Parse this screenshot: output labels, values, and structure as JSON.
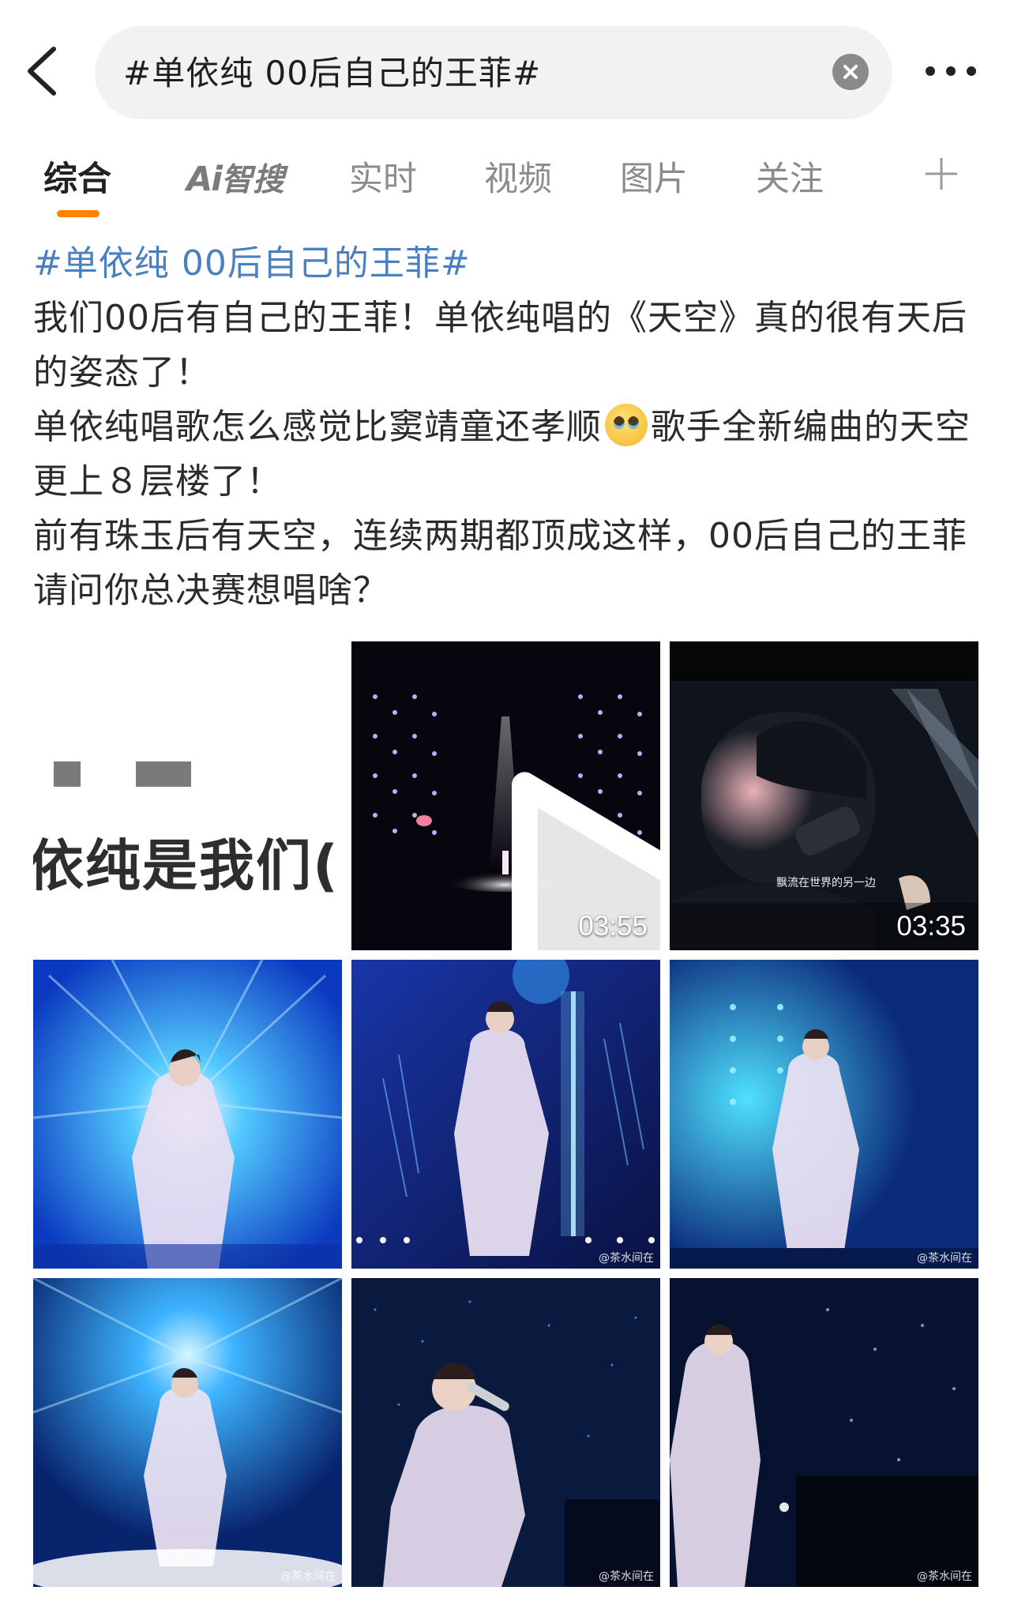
{
  "search": {
    "query": "#单依纯 00后自己的王菲#"
  },
  "tabs": [
    {
      "label": "综合",
      "active": true
    },
    {
      "label": "Ai智搜",
      "active": false
    },
    {
      "label": "实时",
      "active": false
    },
    {
      "label": "视频",
      "active": false
    },
    {
      "label": "图片",
      "active": false
    },
    {
      "label": "关注",
      "active": false
    }
  ],
  "ai_tab": {
    "a": "Ai",
    "b": "智搜"
  },
  "post": {
    "hashtag": "#单依纯 00后自己的王菲#",
    "para1": "我们00后有自己的王菲！单依纯唱的《天空》真的很有天后的姿态了！",
    "para2_a": "单依纯唱歌怎么感觉比窦靖童还孝顺",
    "para2_b": "歌手全新编曲的天空更上８层楼了！",
    "para3": "前有珠玉后有天空，连续两期都顶成这样，00后自己的王菲请问你总决赛想唱啥？"
  },
  "media": {
    "text_card": "依纯是我们(",
    "video1_duration": "03:55",
    "video2_duration": "03:35",
    "video2_subtitle": "飘流在世界的另一边",
    "watermark": "@茶水间在"
  },
  "colors": {
    "accent": "#ff8200",
    "link": "#4a7fc1"
  },
  "icons": [
    "back-icon",
    "clear-icon",
    "more-icon",
    "plus-icon",
    "play-icon",
    "emoji-pleading-icon"
  ]
}
